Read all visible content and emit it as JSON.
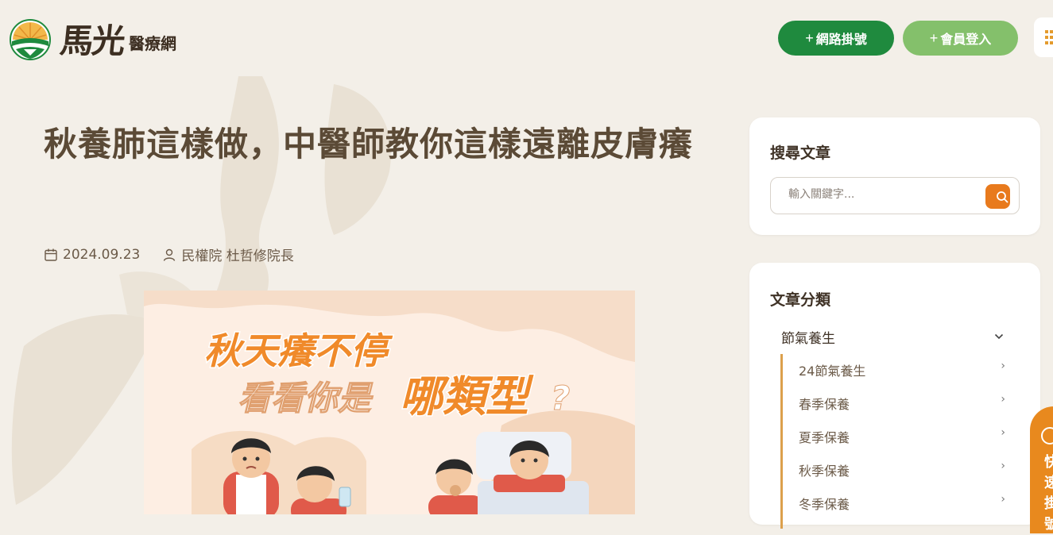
{
  "header": {
    "logo_brand": "馬光",
    "logo_sub": "醫療網",
    "register_button": "網路掛號",
    "login_button": "會員登入",
    "plus": "+"
  },
  "article": {
    "title": "秋養肺這樣做，中醫師教你這樣遠離皮膚癢",
    "date": "2024.09.23",
    "author": "民權院 杜哲修院長",
    "hero": {
      "line1": "秋天癢不停",
      "line2_prefix": "看看你是",
      "line2_emph": "哪類型",
      "line2_suffix": "?"
    }
  },
  "sidebar": {
    "search": {
      "title": "搜尋文章",
      "placeholder": "輸入關鍵字..."
    },
    "categories": {
      "title": "文章分類",
      "main": "節氣養生",
      "items": [
        {
          "label": "24節氣養生"
        },
        {
          "label": "春季保養"
        },
        {
          "label": "夏季保養"
        },
        {
          "label": "秋季保養"
        },
        {
          "label": "冬季保養"
        }
      ]
    }
  },
  "floating_tab": {
    "text": "快速掛號"
  },
  "colors": {
    "background": "#f3efe8",
    "primary_green": "#1f8a3e",
    "light_green": "#84c06b",
    "accent_orange": "#e87a1d"
  }
}
